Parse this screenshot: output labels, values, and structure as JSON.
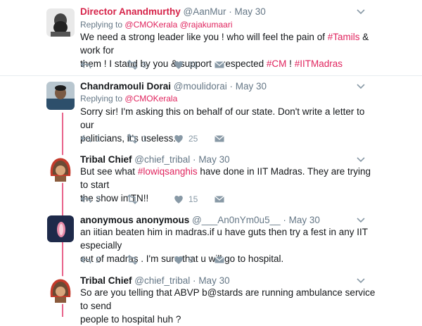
{
  "tweets": [
    {
      "name": "Director Anandmurthy",
      "handle": "@AanMur",
      "date": "May 30",
      "reply_prefix": "Replying to",
      "reply_to": [
        "@CMOKerala",
        "@rajakumaari"
      ],
      "body_lines": [
        [
          {
            "t": "We need a strong leader like you ! who will feel the pain of "
          },
          {
            "t": "#Tamils",
            "tag": true
          },
          {
            "t": " & work for"
          }
        ],
        [
          {
            "t": "them ! I stand by you & support u respected "
          },
          {
            "t": "#CM",
            "tag": true
          },
          {
            "t": " ! "
          },
          {
            "t": "#IITMadras",
            "tag": true
          }
        ]
      ],
      "counts": {
        "reply": "",
        "retweet": "5",
        "like": "31"
      }
    },
    {
      "name": "Chandramouli Dorai",
      "handle": "@moulidorai",
      "date": "May 30",
      "reply_prefix": "Replying to",
      "reply_to": [
        "@CMOKerala"
      ],
      "body_lines": [
        [
          {
            "t": "Sorry sir! I'm asking this on behalf of our state. Don't write a letter to our"
          }
        ],
        [
          {
            "t": "politicians, it's useless."
          }
        ]
      ],
      "counts": {
        "reply": "1",
        "retweet": "1",
        "like": "25"
      }
    },
    {
      "name": "Tribal Chief",
      "handle": "@chief_tribal",
      "date": "May 30",
      "body_lines": [
        [
          {
            "t": "But see what "
          },
          {
            "t": "#lowiqsanghis",
            "tag": true
          },
          {
            "t": " have done in IIT Madras. They are trying to start"
          }
        ],
        [
          {
            "t": "the show in TN!!"
          }
        ]
      ],
      "counts": {
        "reply": "3",
        "retweet": "",
        "like": "15"
      }
    },
    {
      "name": "anonymous anonymous",
      "handle": "@___An0nYm0u5__",
      "date": "May 30",
      "body_lines": [
        [
          {
            "t": "an iitian beaten him in madras.if u have guts then try a fest in any IIT especially"
          }
        ],
        [
          {
            "t": "out of madras . I'm sure that u will go to hospital."
          }
        ]
      ],
      "counts": {
        "reply": "2",
        "retweet": "",
        "like": "8"
      }
    },
    {
      "name": "Tribal Chief",
      "handle": "@chief_tribal",
      "date": "May 30",
      "body_lines": [
        [
          {
            "t": "So are you telling that ABVP b@stards are running ambulance service to send"
          }
        ],
        [
          {
            "t": "people to hospital huh ?"
          }
        ]
      ],
      "counts": {
        "reply": "",
        "retweet": "",
        "like": ""
      }
    }
  ],
  "dot": "·",
  "colors": {
    "accent": "#e0245e",
    "thread": "#e8638a",
    "muted": "#657786",
    "icon": "#8899a6"
  },
  "icons": {
    "reply": "reply-icon",
    "retweet": "retweet-icon",
    "like": "heart-icon",
    "dm": "envelope-icon",
    "more": "chevron-down-icon"
  }
}
